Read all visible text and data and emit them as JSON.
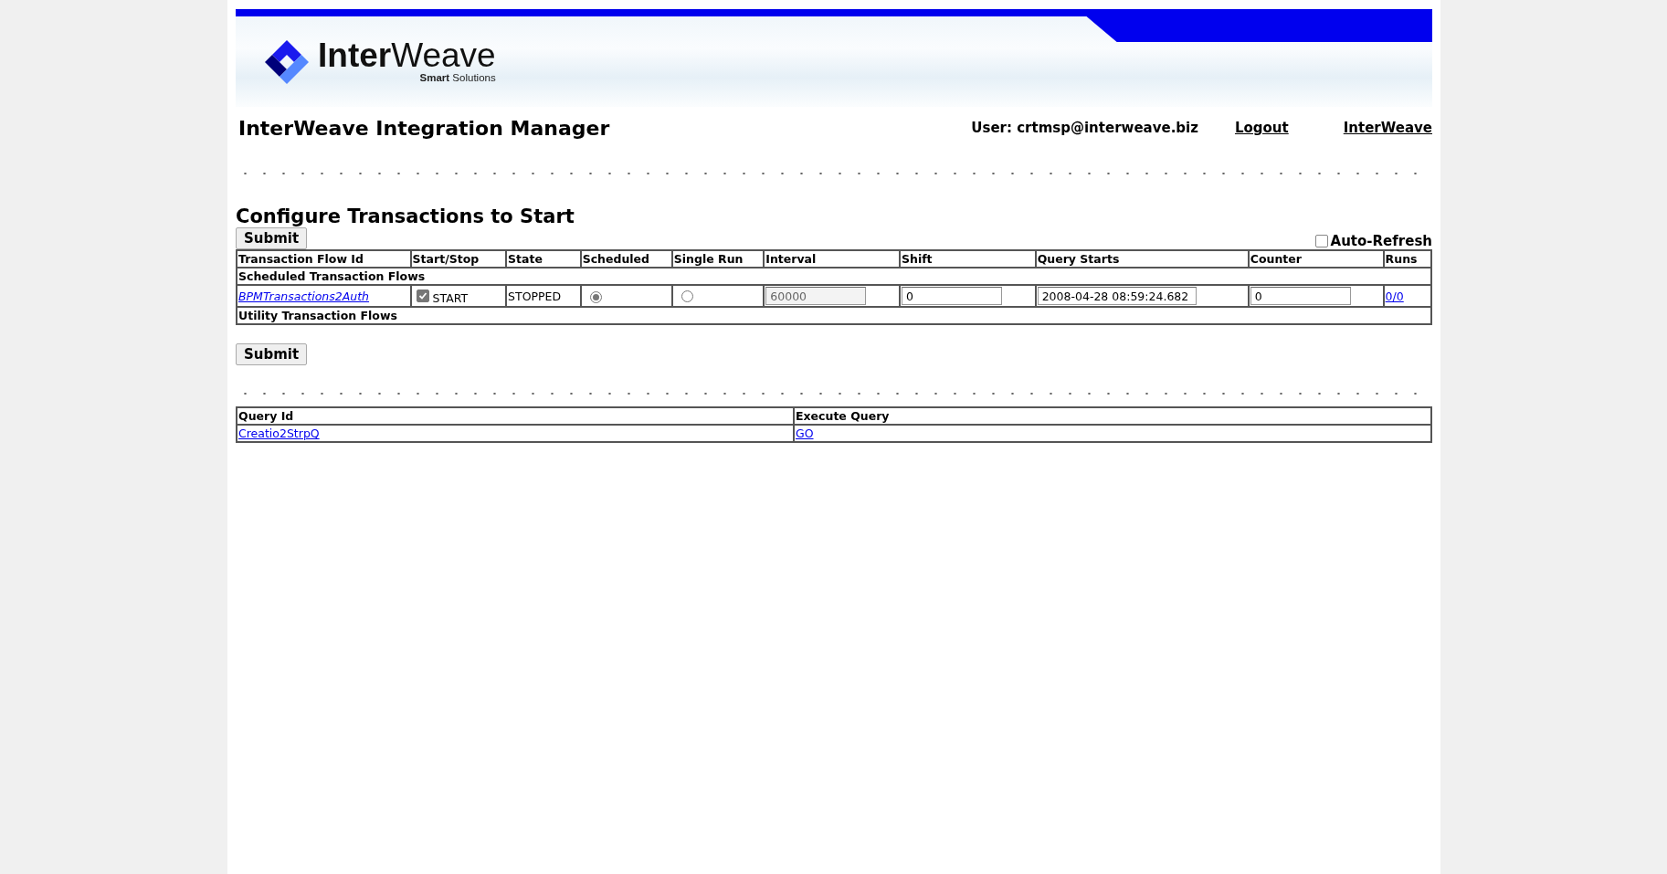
{
  "header": {
    "logo": "**Inter**Weave",
    "tagline": "**Smart** Solutions",
    "title": "InterWeave Integration Manager",
    "user": "User: crtmsp@interweave.biz",
    "links": [
      "Logout",
      "InterWeave"
    ]
  },
  "configure": {
    "heading": "Configure Transactions to Start",
    "submit_top": "Submit",
    "auto_refresh": {
      "label": "Auto-Refresh",
      "checked": false
    },
    "columns": [
      "Transaction Flow Id",
      "Start/Stop",
      "State",
      "Scheduled",
      "Single Run",
      "Interval",
      "Shift",
      "Query Starts",
      "Counter",
      "Runs"
    ],
    "groups": [
      {
        "title": "Scheduled Transaction Flows",
        "rows": [
          {
            "flow_id": "BPMTransactions2Auth",
            "start": {
              "checked": true,
              "label": "START"
            },
            "state": "STOPPED",
            "scheduled": {
              "selected": true
            },
            "single_run": {
              "selected": false
            },
            "interval": {
              "value": "60000",
              "disabled": true
            },
            "shift": "0",
            "query_starts": "2008-04-28 08:59:24.682",
            "counter": "0",
            "runs": "0/0"
          }
        ]
      },
      {
        "title": "Utility Transaction Flows"
      }
    ],
    "submit_bottom": "Submit"
  },
  "queries": {
    "columns": [
      "Query Id",
      "Execute Query"
    ],
    "rows": [
      {
        "query_id": "Creatio2StrpQ",
        "execute": "GO"
      }
    ]
  }
}
